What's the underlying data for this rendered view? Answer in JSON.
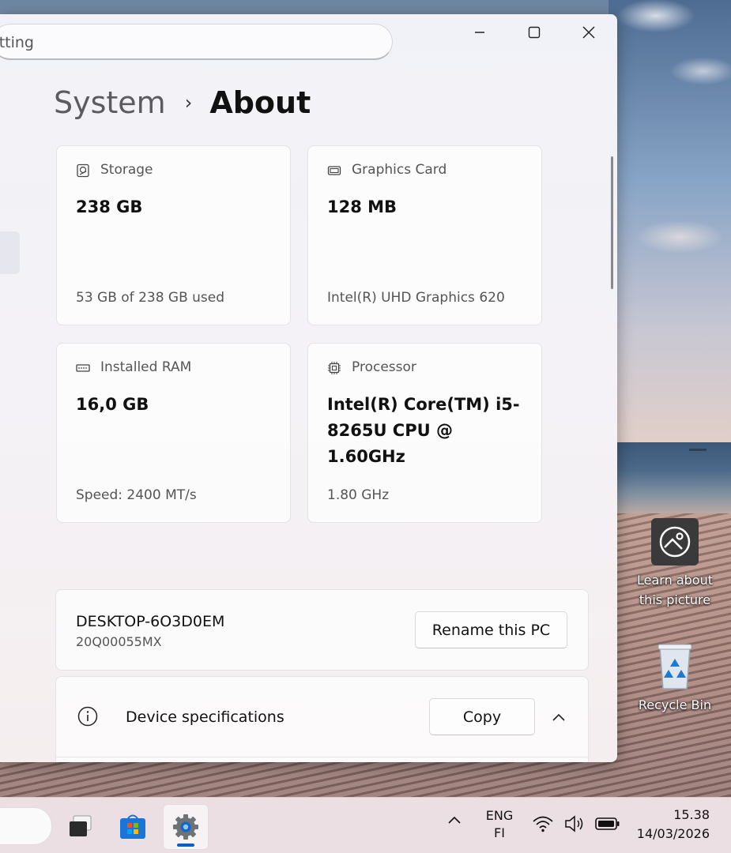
{
  "window": {
    "search_value": "etting",
    "controls": {
      "minimize": "—",
      "maximize": "☐",
      "close": "✕"
    }
  },
  "breadcrumb": {
    "parent": "System",
    "separator": "›",
    "current": "About"
  },
  "cards": {
    "storage": {
      "label": "Storage",
      "value": "238 GB",
      "sub": "53 GB of 238 GB used",
      "icon": "hard-drive-icon"
    },
    "graphics": {
      "label": "Graphics Card",
      "value": "128 MB",
      "sub": "Intel(R) UHD Graphics 620",
      "icon": "graphics-card-icon"
    },
    "ram": {
      "label": "Installed RAM",
      "value": "16,0 GB",
      "sub": "Speed: 2400 MT/s",
      "icon": "ram-icon"
    },
    "processor": {
      "label": "Processor",
      "value": "Intel(R) Core(TM) i5-8265U CPU @ 1.60GHz",
      "sub": "1.80 GHz",
      "icon": "processor-icon"
    }
  },
  "pc": {
    "name": "DESKTOP-6O3D0EM",
    "model": "20Q00055MX",
    "rename_label": "Rename this PC"
  },
  "device_specs": {
    "title": "Device specifications",
    "copy_label": "Copy",
    "icon": "info-icon"
  },
  "desktop": {
    "learn_label": "Learn about this picture",
    "recycle_label": "Recycle Bin"
  },
  "taskbar": {
    "lang_top": "ENG",
    "lang_bottom": "FI",
    "time": "15.38",
    "date": "14/03/2026",
    "accent": "#0a5fc6"
  }
}
